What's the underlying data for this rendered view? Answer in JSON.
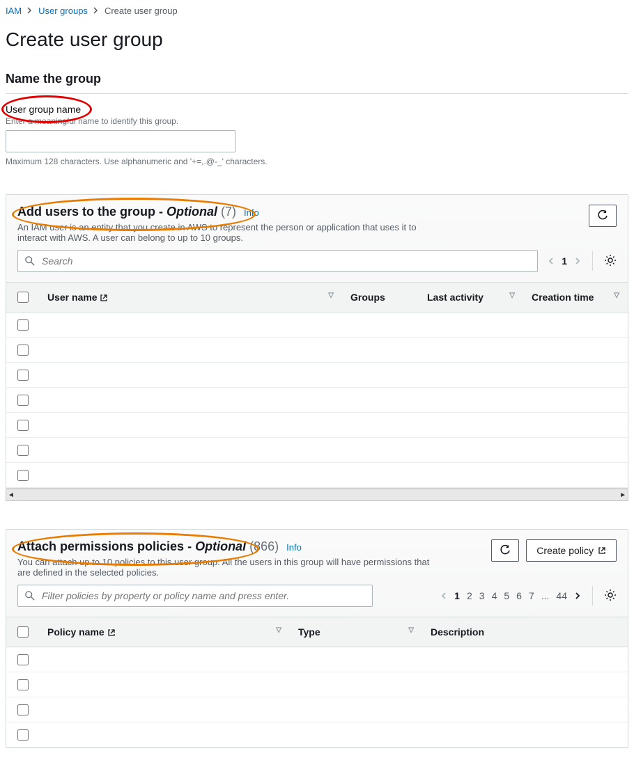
{
  "breadcrumb": {
    "root": "IAM",
    "group": "User groups",
    "current": "Create user group"
  },
  "page_title": "Create user group",
  "name_section": {
    "heading": "Name the group",
    "field_label": "User group name",
    "help": "Enter a meaningful name to identify this group.",
    "hint": "Maximum 128 characters. Use alphanumeric and '+=,.@-_' characters."
  },
  "users_section": {
    "title_prefix": "Add users to the group - ",
    "title_optional": "Optional",
    "count": "(7)",
    "info": "Info",
    "desc": "An IAM user is an entity that you create in AWS to represent the person or application that uses it to interact with AWS. A user can belong to up to 10 groups.",
    "search_placeholder": "Search",
    "page_current": "1",
    "columns": {
      "user": "User name",
      "groups": "Groups",
      "last": "Last activity",
      "created": "Creation time"
    }
  },
  "policies_section": {
    "title_prefix": "Attach permissions policies - ",
    "title_optional": "Optional",
    "count": "(866)",
    "info": "Info",
    "desc": "You can attach up to 10 policies to this user group. All the users in this group will have permissions that are defined in the selected policies.",
    "create_btn": "Create policy",
    "search_placeholder": "Filter policies by property or policy name and press enter.",
    "pages": [
      "1",
      "2",
      "3",
      "4",
      "5",
      "6",
      "7",
      "...",
      "44"
    ],
    "columns": {
      "policy": "Policy name",
      "type": "Type",
      "desc": "Description"
    }
  }
}
